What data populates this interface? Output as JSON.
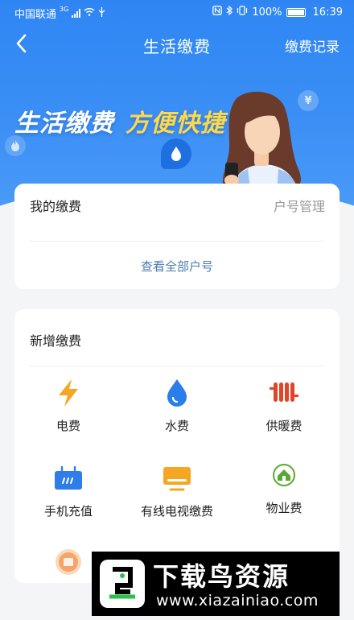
{
  "status_bar": {
    "carrier": "中国联通",
    "network": "3G",
    "battery": "100%",
    "time": "16:39"
  },
  "nav": {
    "title": "生活缴费",
    "right_action": "缴费记录"
  },
  "banner": {
    "slogan_white": "生活缴费",
    "slogan_yellow": "方便快捷",
    "yen": "¥"
  },
  "my_payment": {
    "title": "我的缴费",
    "manage": "户号管理",
    "view_all": "查看全部户号"
  },
  "new_payment": {
    "title": "新增缴费",
    "items": [
      {
        "label": "电费",
        "icon": "lightning-icon",
        "color": "#f5a623"
      },
      {
        "label": "水费",
        "icon": "water-drop-icon",
        "color": "#2b7de9"
      },
      {
        "label": "供暖费",
        "icon": "radiator-icon",
        "color": "#e0452a"
      },
      {
        "label": "手机充值",
        "icon": "sim-card-icon",
        "color": "#2e7de8"
      },
      {
        "label": "有线电视缴费",
        "icon": "tv-icon",
        "color": "#f5a623"
      },
      {
        "label": "物业费",
        "icon": "home-icon",
        "color": "#5aa832"
      },
      {
        "label": "",
        "icon": "gas-icon",
        "color": "#f5a46a"
      }
    ]
  },
  "watermark": {
    "title": "下载鸟资源",
    "url": "www.xiazainiao.com"
  },
  "colors": {
    "brand_blue": "#2f86f3",
    "slogan_yellow": "#ffd84a",
    "link_blue": "#4a7bb0"
  }
}
